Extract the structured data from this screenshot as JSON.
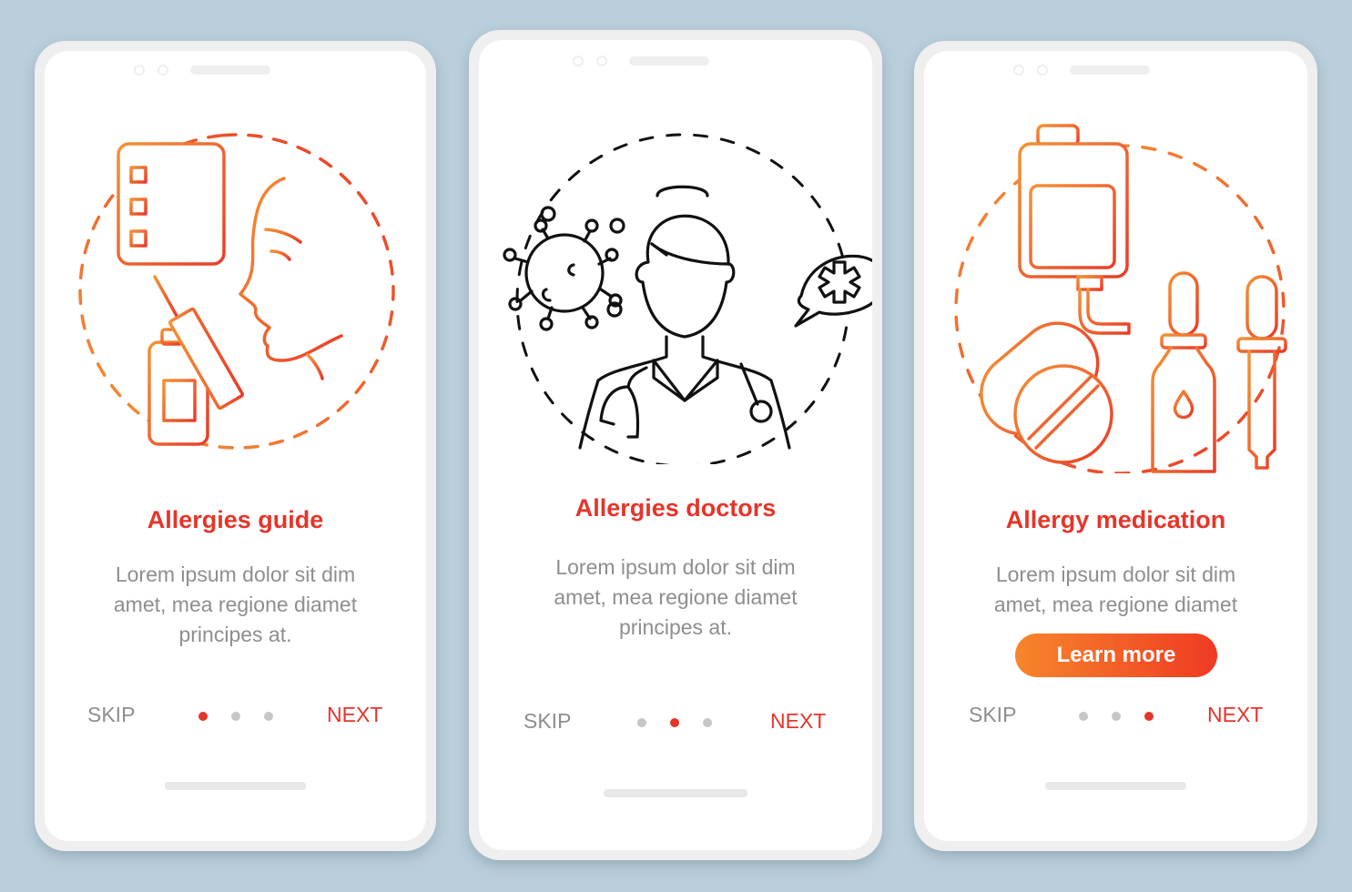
{
  "screens": [
    {
      "title": "Allergies guide",
      "body_lines": [
        "Lorem ipsum dolor sit dim",
        "amet, mea regione diamet",
        "principes at."
      ],
      "skip_label": "SKIP",
      "next_label": "NEXT",
      "active_page": 1,
      "page_count": 3,
      "illustration": "allergy-test-icon"
    },
    {
      "title": "Allergies doctors",
      "body_lines": [
        "Lorem ipsum dolor sit dim",
        "amet, mea regione diamet",
        "principes at."
      ],
      "skip_label": "SKIP",
      "next_label": "NEXT",
      "active_page": 2,
      "page_count": 3,
      "illustration": "doctor-icon"
    },
    {
      "title": "Allergy medication",
      "body_lines": [
        "Lorem ipsum dolor sit dim",
        "amet, mea regione diamet"
      ],
      "cta_label": "Learn more",
      "skip_label": "SKIP",
      "next_label": "NEXT",
      "active_page": 3,
      "page_count": 3,
      "illustration": "medication-icon"
    }
  ],
  "colors": {
    "accent": "#e5352a",
    "gradient_start": "#f7862b",
    "gradient_end": "#ef3a23",
    "body_text": "#8e8e8e",
    "inactive_dot": "#c6c6c6",
    "background": "#bacfdb"
  }
}
